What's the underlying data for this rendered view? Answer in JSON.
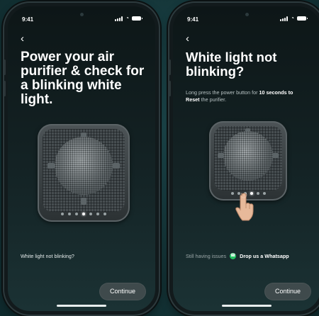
{
  "left_screen": {
    "status_time": "9:41",
    "title": "Power your air purifier & check for a blinking white light.",
    "help_link": "White light not blinking?",
    "continue_label": "Continue"
  },
  "right_screen": {
    "status_time": "9:41",
    "title": "White light not blinking?",
    "instruction_prefix": "Long press the power button for",
    "instruction_bold_1": "10 seconds to",
    "instruction_bold_2": "Reset",
    "instruction_suffix": "the purifier.",
    "help_prefix": "Still having issues",
    "help_action": "Drop us a Whatsapp",
    "continue_label": "Continue"
  },
  "icons": {
    "back": "chevron-left-icon",
    "whatsapp": "whatsapp-icon",
    "hand": "tap-hand-icon"
  },
  "colors": {
    "background": "#143437",
    "button": "#3f4a4c",
    "whatsapp": "#25c264"
  }
}
